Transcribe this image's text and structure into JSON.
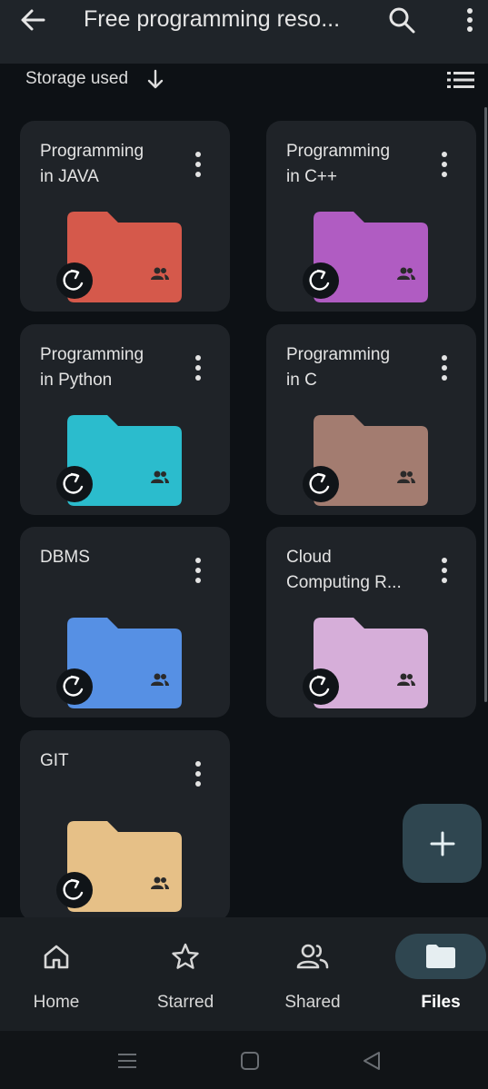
{
  "header": {
    "title": "Free programming reso..."
  },
  "sort": {
    "label": "Storage used"
  },
  "folders": [
    {
      "name": "Programming\nin JAVA",
      "color": "#d5594b"
    },
    {
      "name": "Programming\nin C++",
      "color": "#b05cc2"
    },
    {
      "name": "Programming\nin Python",
      "color": "#2bbccd"
    },
    {
      "name": "Programming\nin C",
      "color": "#a37c70"
    },
    {
      "name": "DBMS",
      "color": "#5690e4"
    },
    {
      "name": "Cloud\nComputing R...",
      "color": "#d6aed9"
    },
    {
      "name": "GIT",
      "color": "#e6c087"
    }
  ],
  "fab": {
    "icon": "plus-icon"
  },
  "bottom_nav": {
    "items": [
      {
        "label": "Home",
        "icon": "home-icon"
      },
      {
        "label": "Starred",
        "icon": "star-icon"
      },
      {
        "label": "Shared",
        "icon": "people-icon"
      },
      {
        "label": "Files",
        "icon": "folder-icon",
        "active": true
      }
    ]
  },
  "colors": {
    "accent": "#2f4650",
    "surface": "#1f2328",
    "background": "#0d1115"
  }
}
